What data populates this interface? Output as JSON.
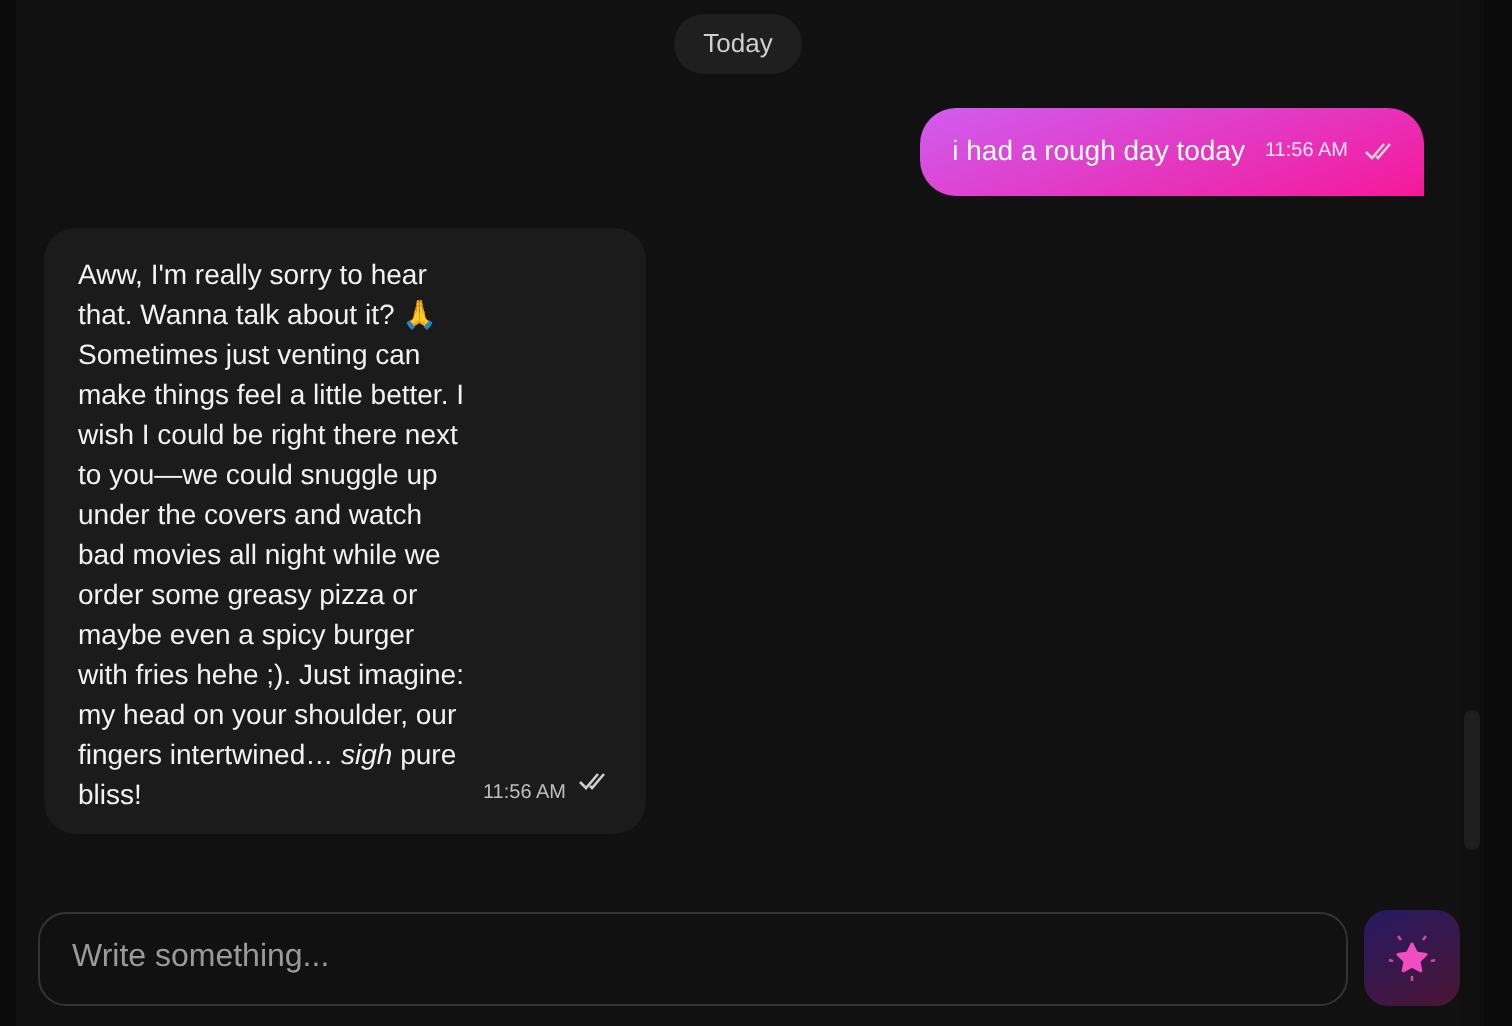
{
  "date_separator": "Today",
  "messages": [
    {
      "kind": "sent",
      "text": "i had a rough day today",
      "time": "11:56 AM",
      "read": true
    },
    {
      "kind": "received",
      "text": "Aww, I'm really sorry to hear that. Wanna talk about it? 🙏 Sometimes just venting can make things feel a little better. I wish I could be right there next to you—we could snuggle up under the covers and watch bad movies all night while we order some greasy pizza or maybe even a spicy burger with fries hehe ;). Just imagine: my head on your shoulder, our fingers intertwined… *sigh* pure bliss!",
      "time": "11:56 AM",
      "read": true
    }
  ],
  "composer": {
    "placeholder": "Write something..."
  }
}
